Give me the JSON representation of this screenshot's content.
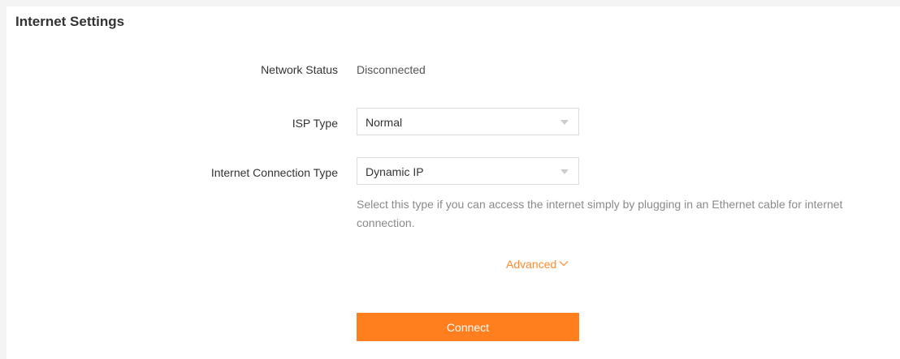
{
  "section": {
    "title": "Internet Settings"
  },
  "network_status": {
    "label": "Network Status",
    "value": "Disconnected"
  },
  "isp_type": {
    "label": "ISP Type",
    "selected": "Normal"
  },
  "connection_type": {
    "label": "Internet Connection Type",
    "selected": "Dynamic IP",
    "hint": "Select this type if you can access the internet simply by plugging in an Ethernet cable for internet connection."
  },
  "advanced": {
    "label": "Advanced",
    "icon": "chevron-down-icon"
  },
  "connect_button": {
    "label": "Connect"
  },
  "colors": {
    "accent": "#ff7f1e",
    "link": "#ff8a2b",
    "hint_text": "#8a8a8a"
  }
}
